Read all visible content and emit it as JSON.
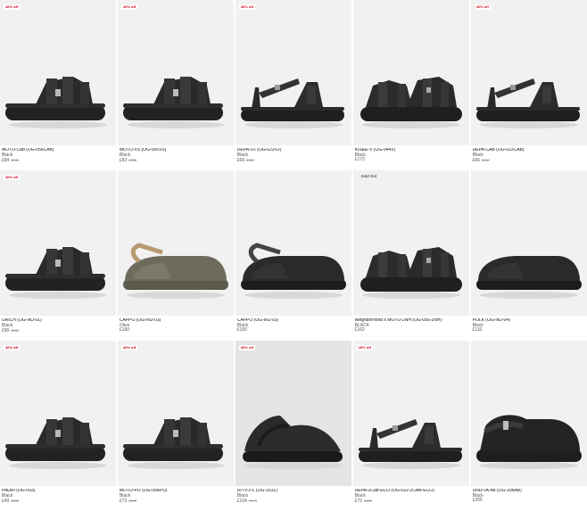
{
  "products": [
    {
      "badge": "40% off",
      "name": "MOTO-Cab (OG-056CAB)",
      "color": "Black",
      "price": "£84",
      "old_price": "£140",
      "shape": "slide"
    },
    {
      "badge": "40% off",
      "name": "MOTO-VS (OG-056VS)",
      "color": "Black",
      "price": "£83",
      "old_price": "£138",
      "shape": "slide"
    },
    {
      "badge": "40% off",
      "name": "DEPA-V2 (OG-022V2)",
      "color": "Black",
      "price": "£66",
      "old_price": "£110",
      "shape": "strap"
    },
    {
      "badge": "",
      "name": "KISEE-V (OG-044V)",
      "color": "Black",
      "price": "£173",
      "old_price": "",
      "shape": "multi"
    },
    {
      "badge": "40% off",
      "name": "DEPA-CAB (OG-022CAB)",
      "color": "Black",
      "price": "£66",
      "old_price": "£110",
      "shape": "strap"
    },
    {
      "badge": "40% off",
      "name": "URICH (OG-INJ-01)",
      "color": "Black",
      "price": "£90",
      "old_price": "£150",
      "shape": "slide"
    },
    {
      "badge": "",
      "name": "CAPPO (OG-INJ-03)",
      "color": "Olive",
      "price": "£160",
      "old_price": "",
      "shape": "clog-olive"
    },
    {
      "badge": "",
      "name": "CAPPO (OG-INJ-03)",
      "color": "Black",
      "price": "£160",
      "old_price": "",
      "shape": "clog"
    },
    {
      "badge": "Sold Out",
      "name": "Neighborhood x MOTO-2NH (OG-056-2NH)",
      "color": "BLACK",
      "price": "£162",
      "old_price": "",
      "shape": "multi"
    },
    {
      "badge": "",
      "name": "POLK (OG-INJ-04)",
      "color": "Black",
      "price": "£110",
      "old_price": "",
      "shape": "clog-plain"
    },
    {
      "badge": "40% off",
      "name": "PADRI (OG-093)",
      "color": "Black",
      "price": "£40",
      "old_price": "£100",
      "shape": "slide"
    },
    {
      "badge": "40% off",
      "name": "MOTO-PO (OG-056PO)",
      "color": "Black",
      "price": "£73",
      "old_price": "£122",
      "shape": "slide"
    },
    {
      "badge": "40% off",
      "name": "DITV-2-L (OG-161L)",
      "color": "Black",
      "price": "£104",
      "old_price": "£173",
      "shape": "suede"
    },
    {
      "badge": "40% off",
      "name": "DEPA-2Cab-ECO (OG-022-2CAB-ECO)",
      "color": "Black",
      "price": "£72",
      "old_price": "£120",
      "shape": "strap"
    },
    {
      "badge": "",
      "name": "UNDITA-Ab (OG-206AB)",
      "color": "Black",
      "price": "£205",
      "old_price": "",
      "shape": "closed"
    }
  ]
}
